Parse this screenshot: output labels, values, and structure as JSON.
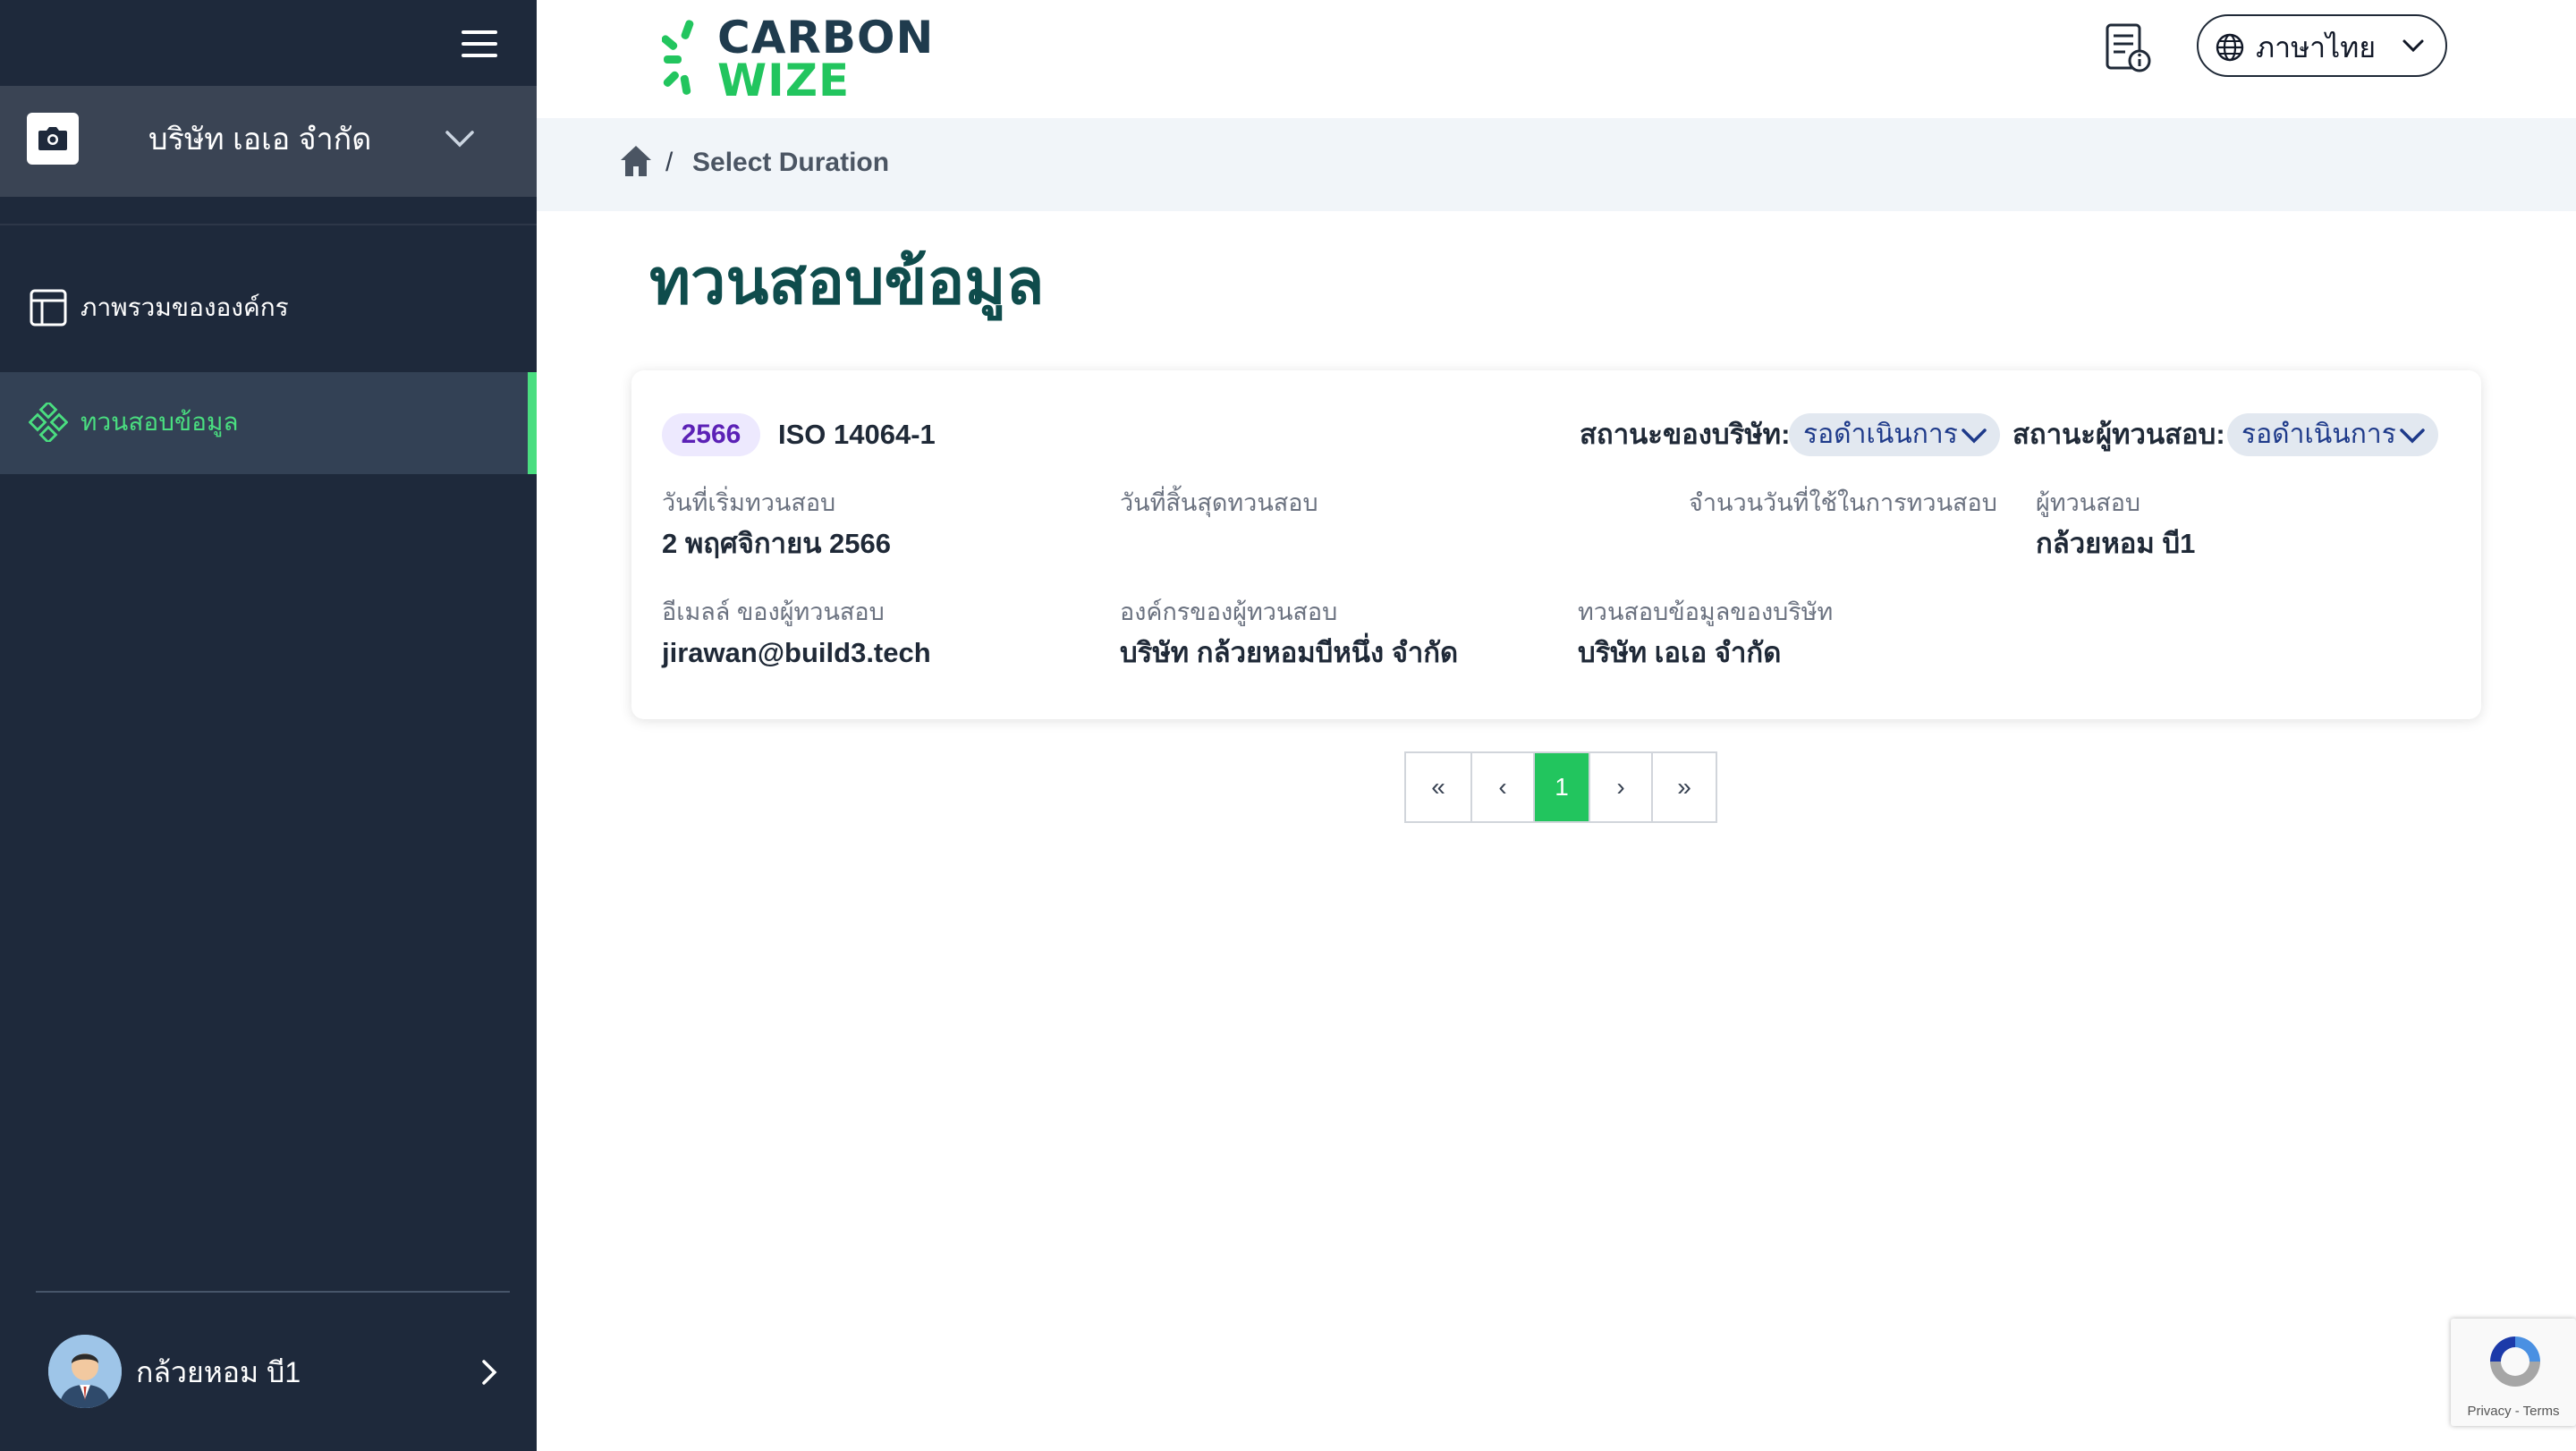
{
  "sidebar": {
    "company_name": "บริษัท เอเอ จำกัด",
    "nav": [
      {
        "label": "ภาพรวมขององค์กร",
        "icon": "layout-icon",
        "active": false
      },
      {
        "label": "ทวนสอบข้อมูล",
        "icon": "diamond-grid-icon",
        "active": true
      }
    ],
    "user_name": "กล้วยหอม บี1"
  },
  "header": {
    "brand_line1": "CARBON",
    "brand_line2": "WIZE",
    "language": "ภาษาไทย"
  },
  "breadcrumb": {
    "separator": "/",
    "current": "Select Duration"
  },
  "page": {
    "title": "ทวนสอบข้อมูล"
  },
  "card": {
    "year": "2566",
    "standard": "ISO 14064-1",
    "company_status_label": "สถานะของบริษัท:",
    "company_status": "รอดำเนินการ",
    "verifier_status_label": "สถานะผู้ทวนสอบ:",
    "verifier_status": "รอดำเนินการ",
    "fields": {
      "start_label": "วันที่เริ่มทวนสอบ",
      "start_value": "2 พฤศจิกายน 2566",
      "end_label": "วันที่สิ้นสุดทวนสอบ",
      "end_value": "",
      "days_label": "จำนวนวันที่ใช้ในการทวนสอบ",
      "days_value": "",
      "verifier_label": "ผู้ทวนสอบ",
      "verifier_value": "กล้วยหอม บี1",
      "email_label": "อีเมลล์ ของผู้ทวนสอบ",
      "email_value": "jirawan@build3.tech",
      "org_label": "องค์กรของผู้ทวนสอบ",
      "org_value": "บริษัท กล้วยหอมบีหนึ่ง จำกัด",
      "company_label": "ทวนสอบข้อมูลของบริษัท",
      "company_value": "บริษัท เอเอ จำกัด"
    }
  },
  "pagination": {
    "first": "«",
    "prev": "‹",
    "current": "1",
    "next": "›",
    "last": "»"
  },
  "recaptcha": {
    "text": "Privacy - Terms"
  },
  "colors": {
    "sidebar_bg": "#1e293b",
    "accent_green": "#22c55e",
    "title_teal": "#0f4c4c"
  }
}
